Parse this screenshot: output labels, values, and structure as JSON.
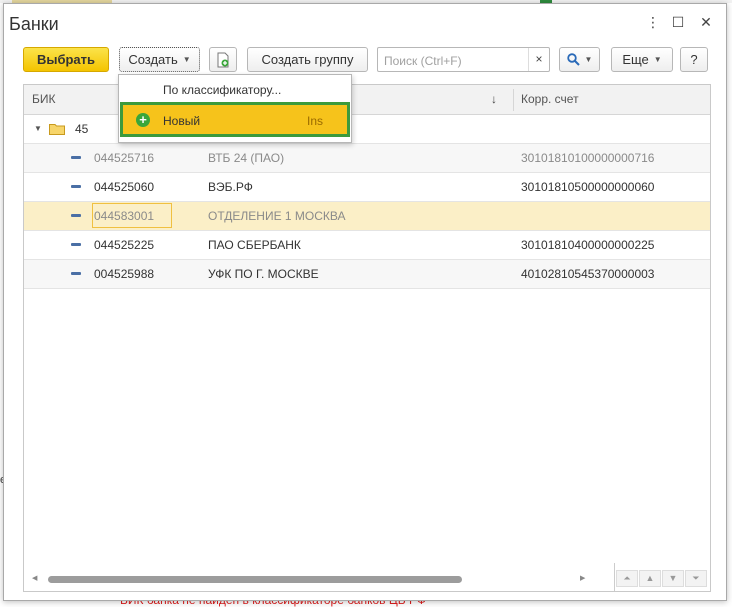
{
  "window": {
    "title": "Банки",
    "controls": {
      "menu": "⋮",
      "maximize": "☐",
      "close": "✕"
    }
  },
  "toolbar": {
    "select_label": "Выбрать",
    "create_label": "Создать",
    "create_group_label": "Создать группу",
    "search_placeholder": "Поиск (Ctrl+F)",
    "search_clear": "×",
    "more_label": "Еще",
    "help_label": "?"
  },
  "dropdown": {
    "items": [
      {
        "label": "По классификатору..."
      },
      {
        "label": "Новый",
        "shortcut": "Ins"
      }
    ]
  },
  "table": {
    "columns": [
      "БИК",
      "",
      "Корр. счет"
    ],
    "sort_indicator": "↓",
    "group": {
      "label": "45"
    },
    "rows": [
      {
        "bik": "044525716",
        "name": "ВТБ 24 (ПАО)",
        "account": "30101810100000000716"
      },
      {
        "bik": "044525060",
        "name": "ВЭБ.РФ",
        "account": "30101810500000000060"
      },
      {
        "bik": "044583001",
        "name": "ОТДЕЛЕНИЕ 1 МОСКВА",
        "account": ""
      },
      {
        "bik": "044525225",
        "name": "ПАО СБЕРБАНК",
        "account": "30101810400000000225"
      },
      {
        "bik": "004525988",
        "name": "УФК ПО Г. МОСКВЕ",
        "account": "40102810545370000003"
      }
    ]
  },
  "background": {
    "bottom_text": "БИК банка не найден в классификаторе банков ЦБ РФ",
    "left_char": "е"
  },
  "colors": {
    "accent": "#f4c400",
    "highlight_border": "#3c9a3c",
    "selected_row": "#fbefc7"
  }
}
